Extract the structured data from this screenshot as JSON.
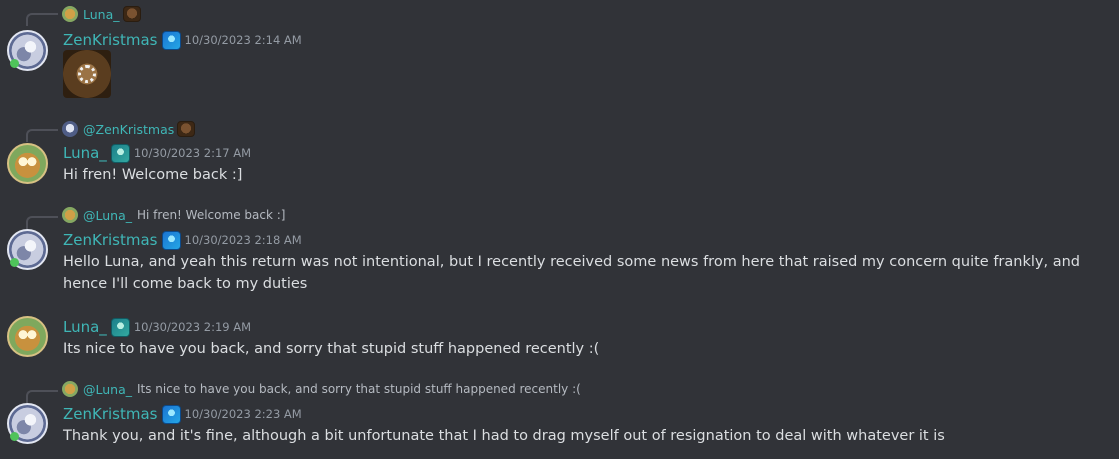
{
  "messages": [
    {
      "reply": {
        "name": "Luna_"
      },
      "author": "ZenKristmas",
      "timestamp": "10/30/2023 2:14 AM",
      "attachment": "image-loading"
    },
    {
      "reply": {
        "name": "@ZenKristmas"
      },
      "author": "Luna_",
      "timestamp": "10/30/2023 2:17 AM",
      "text": "Hi fren! Welcome back :]"
    },
    {
      "reply": {
        "name": "@Luna_",
        "text": "Hi fren! Welcome back :]"
      },
      "author": "ZenKristmas",
      "timestamp": "10/30/2023 2:18 AM",
      "text": "Hello Luna, and yeah this return was not intentional, but I recently received some news from here that raised my concern quite frankly, and hence I'll come back to my duties"
    },
    {
      "author": "Luna_",
      "timestamp": "10/30/2023 2:19 AM",
      "text": "Its nice to have you back, and sorry that stupid stuff happened recently :("
    },
    {
      "reply": {
        "name": "@Luna_",
        "text": "Its nice to have you back, and sorry that stupid stuff happened recently :("
      },
      "author": "ZenKristmas",
      "timestamp": "10/30/2023 2:23 AM",
      "text": "Thank you, and it's fine, although a bit unfortunate that I had to drag myself out of resignation to deal with whatever it is"
    }
  ],
  "colors": {
    "background": "#313338",
    "username": "#3fb6b6",
    "text": "#dbdee1",
    "timestamp": "#949ba4"
  },
  "icons": {
    "badge": "crystal-badge-icon",
    "reply_decoration": "cat-avatar-decoration-icon",
    "attachment_spinner": "loading-spinner-icon"
  }
}
